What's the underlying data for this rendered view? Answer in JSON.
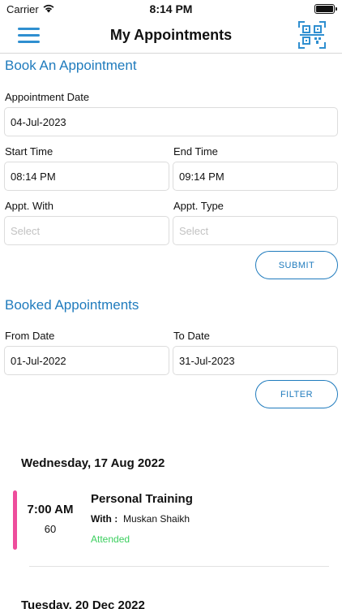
{
  "status": {
    "carrier": "Carrier",
    "time": "8:14 PM"
  },
  "nav": {
    "title": "My Appointments",
    "menu_icon": "hamburger-menu-icon",
    "qr_icon": "qr-code-icon"
  },
  "book": {
    "title": "Book An Appointment",
    "date_label": "Appointment Date",
    "date_value": "04-Jul-2023",
    "start_label": "Start Time",
    "start_value": "08:14 PM",
    "end_label": "End Time",
    "end_value": "09:14 PM",
    "with_label": "Appt. With",
    "with_placeholder": "Select",
    "type_label": "Appt. Type",
    "type_placeholder": "Select",
    "submit_label": "SUBMIT"
  },
  "booked": {
    "title": "Booked Appointments",
    "from_label": "From Date",
    "from_value": "01-Jul-2022",
    "to_label": "To Date",
    "to_value": "31-Jul-2023",
    "filter_label": "FILTER"
  },
  "appointments": [
    {
      "day": "Wednesday, 17 Aug 2022",
      "time": "7:00 AM",
      "duration": "60",
      "title": "Personal Training",
      "with_label": "With :",
      "with": "Muskan Shaikh",
      "status": "Attended",
      "status_color": "#3ccf5f",
      "bar_color": "#ee4d9c"
    }
  ],
  "next_day": "Tuesday, 20 Dec 2022",
  "colors": {
    "accent": "#1f7bbd",
    "menu": "#2f8fd0"
  }
}
